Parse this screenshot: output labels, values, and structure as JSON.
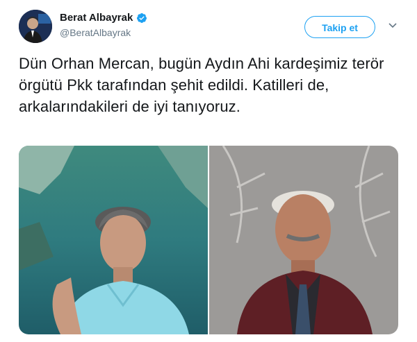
{
  "author": {
    "name": "Berat Albayrak",
    "handle": "@BeratAlbayrak",
    "verified_icon": "verified-badge-icon"
  },
  "actions": {
    "follow_label": "Takip et",
    "more_icon": "chevron-down-icon"
  },
  "tweet": {
    "text": "Dün Orhan Mercan, bugün Aydın Ahi kardeşimiz terör örgütü Pkk tarafından şehit edildi. Katilleri de, arkalarındakileri de iyi tanıyoruz."
  },
  "colors": {
    "accent": "#1da1f2",
    "text": "#14171a",
    "muted": "#657786"
  }
}
